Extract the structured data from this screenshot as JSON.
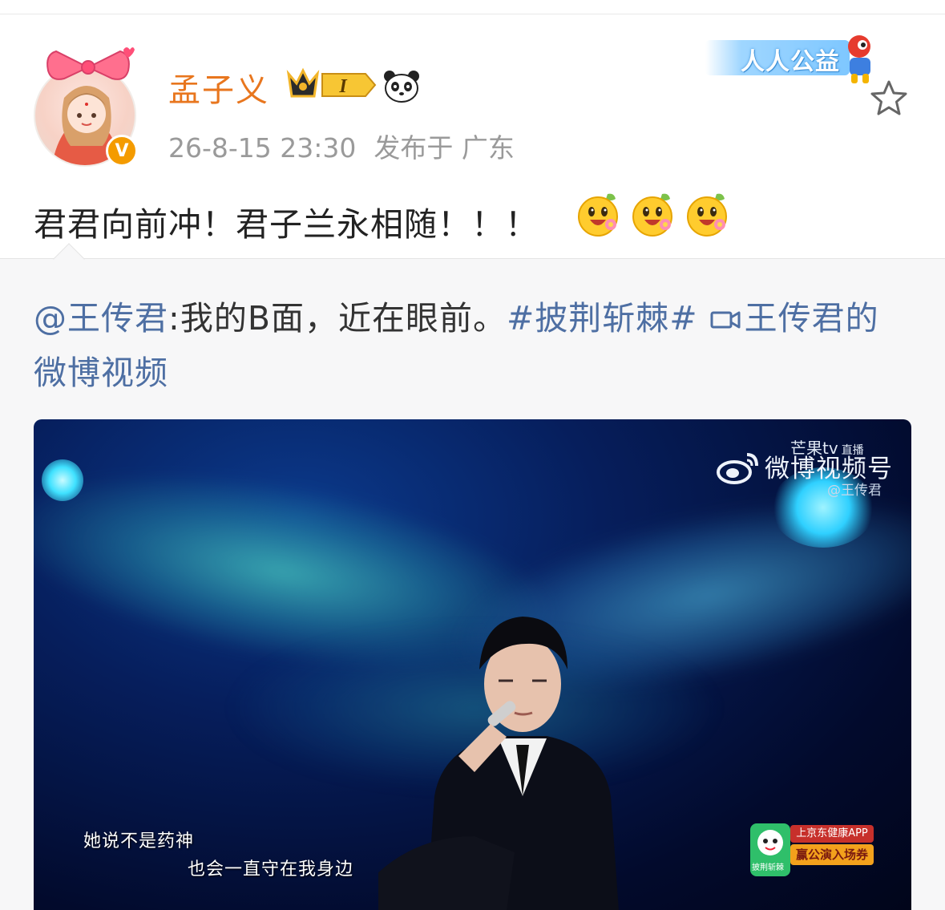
{
  "post": {
    "username": "孟子义",
    "vip_level": "I",
    "verified_mark": "V",
    "timestamp": "26-8-15 23:30",
    "location": "发布于 广东",
    "charity_badge": "人人公益",
    "text": "君君向前冲！君子兰永相随！！！",
    "emojis": [
      "happy-flower-emoji",
      "happy-flower-emoji",
      "happy-flower-emoji"
    ]
  },
  "repost": {
    "mention": "@王传君",
    "body": ":我的B面，近在眼前。",
    "hashtag": "#披荆斩棘#",
    "video_link": "王传君的微博视频"
  },
  "video": {
    "watermark_top": "芒果tv",
    "watermark_live": "直播",
    "watermark_main": "微博视频号",
    "watermark_handle": "@王传君",
    "subtitle_1": "她说不是药神",
    "subtitle_2": "也会一直守在我身边",
    "ad_line1": "上京东健康APP",
    "ad_line2": "赢公演入场券",
    "ad_tag": "披荆斩棘"
  },
  "colors": {
    "username": "#e8761e",
    "link": "#4e6fa3",
    "meta": "#9a9a9a",
    "repost_bg": "#f7f7f8"
  }
}
